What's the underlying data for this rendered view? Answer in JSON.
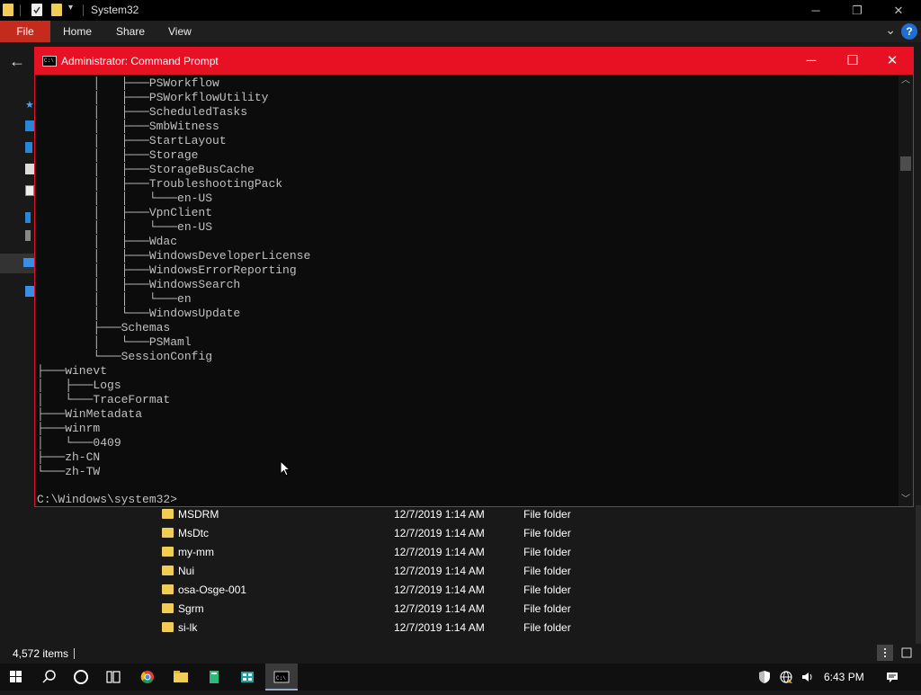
{
  "explorer": {
    "title": "System32",
    "ribbon_tabs": {
      "file": "File",
      "home": "Home",
      "share": "Share",
      "view": "View"
    },
    "help_label": "?",
    "files": [
      {
        "name": "MSDRM",
        "date": "12/7/2019 1:14 AM",
        "type": "File folder"
      },
      {
        "name": "MsDtc",
        "date": "12/7/2019 1:14 AM",
        "type": "File folder"
      },
      {
        "name": "my-mm",
        "date": "12/7/2019 1:14 AM",
        "type": "File folder"
      },
      {
        "name": "Nui",
        "date": "12/7/2019 1:14 AM",
        "type": "File folder"
      },
      {
        "name": "osa-Osge-001",
        "date": "12/7/2019 1:14 AM",
        "type": "File folder"
      },
      {
        "name": "Sgrm",
        "date": "12/7/2019 1:14 AM",
        "type": "File folder"
      },
      {
        "name": "si-lk",
        "date": "12/7/2019 1:14 AM",
        "type": "File folder"
      }
    ],
    "status": {
      "item_count": "4,572 items"
    }
  },
  "cmd": {
    "title": "Administrator: Command Prompt",
    "icon_text": "C:\\",
    "lines": [
      "        │   ├───PSWorkflow",
      "        │   ├───PSWorkflowUtility",
      "        │   ├───ScheduledTasks",
      "        │   ├───SmbWitness",
      "        │   ├───StartLayout",
      "        │   ├───Storage",
      "        │   ├───StorageBusCache",
      "        │   ├───TroubleshootingPack",
      "        │   │   └───en-US",
      "        │   ├───VpnClient",
      "        │   │   └───en-US",
      "        │   ├───Wdac",
      "        │   ├───WindowsDeveloperLicense",
      "        │   ├───WindowsErrorReporting",
      "        │   ├───WindowsSearch",
      "        │   │   └───en",
      "        │   └───WindowsUpdate",
      "        ├───Schemas",
      "        │   └───PSMaml",
      "        └───SessionConfig",
      "├───winevt",
      "│   ├───Logs",
      "│   └───TraceFormat",
      "├───WinMetadata",
      "├───winrm",
      "│   └───0409",
      "├───zh-CN",
      "└───zh-TW"
    ],
    "prompt": "C:\\Windows\\system32>"
  },
  "taskbar": {
    "time": "6:43 PM"
  },
  "colors": {
    "accent_red": "#e81123",
    "file_tab": "#c42b1c",
    "folder": "#f2cd55",
    "console_text": "#c0c0c0"
  },
  "icons": {
    "start": "windows-logo-icon",
    "search": "search-icon",
    "cortana": "cortana-circle-icon",
    "task_view": "task-view-icon",
    "chrome": "chrome-icon",
    "explorer": "file-explorer-icon",
    "notepad": "app-icon",
    "network_app": "network-app-icon",
    "cmd": "command-prompt-icon"
  }
}
